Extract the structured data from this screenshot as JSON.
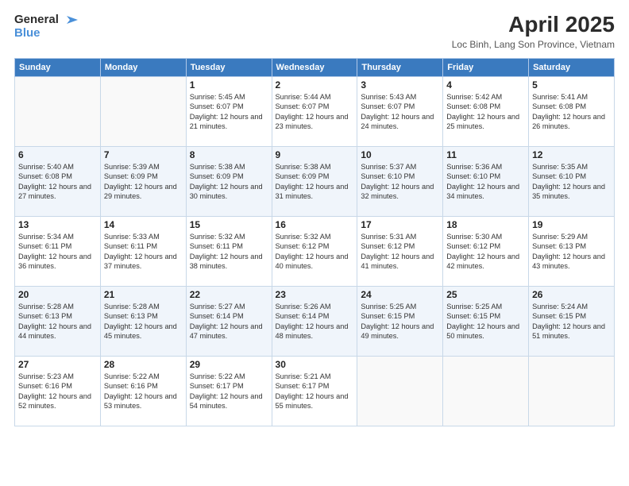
{
  "header": {
    "logo_line1": "General",
    "logo_line2": "Blue",
    "month_title": "April 2025",
    "location": "Loc Binh, Lang Son Province, Vietnam"
  },
  "days_of_week": [
    "Sunday",
    "Monday",
    "Tuesday",
    "Wednesday",
    "Thursday",
    "Friday",
    "Saturday"
  ],
  "weeks": [
    [
      {
        "day": "",
        "info": ""
      },
      {
        "day": "",
        "info": ""
      },
      {
        "day": "1",
        "info": "Sunrise: 5:45 AM\nSunset: 6:07 PM\nDaylight: 12 hours and 21 minutes."
      },
      {
        "day": "2",
        "info": "Sunrise: 5:44 AM\nSunset: 6:07 PM\nDaylight: 12 hours and 23 minutes."
      },
      {
        "day": "3",
        "info": "Sunrise: 5:43 AM\nSunset: 6:07 PM\nDaylight: 12 hours and 24 minutes."
      },
      {
        "day": "4",
        "info": "Sunrise: 5:42 AM\nSunset: 6:08 PM\nDaylight: 12 hours and 25 minutes."
      },
      {
        "day": "5",
        "info": "Sunrise: 5:41 AM\nSunset: 6:08 PM\nDaylight: 12 hours and 26 minutes."
      }
    ],
    [
      {
        "day": "6",
        "info": "Sunrise: 5:40 AM\nSunset: 6:08 PM\nDaylight: 12 hours and 27 minutes."
      },
      {
        "day": "7",
        "info": "Sunrise: 5:39 AM\nSunset: 6:09 PM\nDaylight: 12 hours and 29 minutes."
      },
      {
        "day": "8",
        "info": "Sunrise: 5:38 AM\nSunset: 6:09 PM\nDaylight: 12 hours and 30 minutes."
      },
      {
        "day": "9",
        "info": "Sunrise: 5:38 AM\nSunset: 6:09 PM\nDaylight: 12 hours and 31 minutes."
      },
      {
        "day": "10",
        "info": "Sunrise: 5:37 AM\nSunset: 6:10 PM\nDaylight: 12 hours and 32 minutes."
      },
      {
        "day": "11",
        "info": "Sunrise: 5:36 AM\nSunset: 6:10 PM\nDaylight: 12 hours and 34 minutes."
      },
      {
        "day": "12",
        "info": "Sunrise: 5:35 AM\nSunset: 6:10 PM\nDaylight: 12 hours and 35 minutes."
      }
    ],
    [
      {
        "day": "13",
        "info": "Sunrise: 5:34 AM\nSunset: 6:11 PM\nDaylight: 12 hours and 36 minutes."
      },
      {
        "day": "14",
        "info": "Sunrise: 5:33 AM\nSunset: 6:11 PM\nDaylight: 12 hours and 37 minutes."
      },
      {
        "day": "15",
        "info": "Sunrise: 5:32 AM\nSunset: 6:11 PM\nDaylight: 12 hours and 38 minutes."
      },
      {
        "day": "16",
        "info": "Sunrise: 5:32 AM\nSunset: 6:12 PM\nDaylight: 12 hours and 40 minutes."
      },
      {
        "day": "17",
        "info": "Sunrise: 5:31 AM\nSunset: 6:12 PM\nDaylight: 12 hours and 41 minutes."
      },
      {
        "day": "18",
        "info": "Sunrise: 5:30 AM\nSunset: 6:12 PM\nDaylight: 12 hours and 42 minutes."
      },
      {
        "day": "19",
        "info": "Sunrise: 5:29 AM\nSunset: 6:13 PM\nDaylight: 12 hours and 43 minutes."
      }
    ],
    [
      {
        "day": "20",
        "info": "Sunrise: 5:28 AM\nSunset: 6:13 PM\nDaylight: 12 hours and 44 minutes."
      },
      {
        "day": "21",
        "info": "Sunrise: 5:28 AM\nSunset: 6:13 PM\nDaylight: 12 hours and 45 minutes."
      },
      {
        "day": "22",
        "info": "Sunrise: 5:27 AM\nSunset: 6:14 PM\nDaylight: 12 hours and 47 minutes."
      },
      {
        "day": "23",
        "info": "Sunrise: 5:26 AM\nSunset: 6:14 PM\nDaylight: 12 hours and 48 minutes."
      },
      {
        "day": "24",
        "info": "Sunrise: 5:25 AM\nSunset: 6:15 PM\nDaylight: 12 hours and 49 minutes."
      },
      {
        "day": "25",
        "info": "Sunrise: 5:25 AM\nSunset: 6:15 PM\nDaylight: 12 hours and 50 minutes."
      },
      {
        "day": "26",
        "info": "Sunrise: 5:24 AM\nSunset: 6:15 PM\nDaylight: 12 hours and 51 minutes."
      }
    ],
    [
      {
        "day": "27",
        "info": "Sunrise: 5:23 AM\nSunset: 6:16 PM\nDaylight: 12 hours and 52 minutes."
      },
      {
        "day": "28",
        "info": "Sunrise: 5:22 AM\nSunset: 6:16 PM\nDaylight: 12 hours and 53 minutes."
      },
      {
        "day": "29",
        "info": "Sunrise: 5:22 AM\nSunset: 6:17 PM\nDaylight: 12 hours and 54 minutes."
      },
      {
        "day": "30",
        "info": "Sunrise: 5:21 AM\nSunset: 6:17 PM\nDaylight: 12 hours and 55 minutes."
      },
      {
        "day": "",
        "info": ""
      },
      {
        "day": "",
        "info": ""
      },
      {
        "day": "",
        "info": ""
      }
    ]
  ]
}
